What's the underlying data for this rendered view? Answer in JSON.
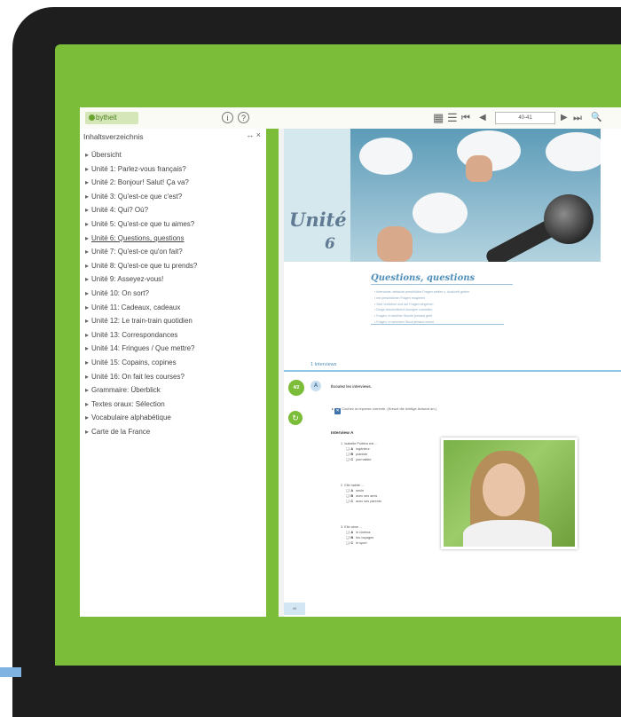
{
  "app": {
    "logo_text": "bytheit"
  },
  "toolbar": {
    "info_label": "i",
    "help_label": "?",
    "grid_icon": "▦",
    "list_icon": "☰",
    "first_icon": "⏮",
    "prev_icon": "◀",
    "page_value": "40-41",
    "next_icon": "▶",
    "last_icon": "⏭",
    "zoom_icon": "🔍"
  },
  "toc": {
    "title": "Inhaltsverzeichnis",
    "expand_label": "↔",
    "close_label": "×",
    "items": [
      "Übersicht",
      "Unité 1: Parlez-vous français?",
      "Unité 2: Bonjour! Salut! Ça va?",
      "Unité 3: Qu'est-ce que c'est?",
      "Unité 4: Qui? Où?",
      "Unité 5: Qu'est-ce que tu aimes?",
      "Unité 6: Questions, questions",
      "Unité 7: Qu'est-ce qu'on fait?",
      "Unité 8: Qu'est-ce que tu prends?",
      "Unité 9: Asseyez-vous!",
      "Unité 10: On sort?",
      "Unité 11: Cadeaux, cadeaux",
      "Unité 12: Le train-train quotidien",
      "Unité 13: Correspondances",
      "Unité 14: Fringues / Que mettre?",
      "Unité 15: Copains, copines",
      "Unité 16: On fait les courses?",
      "Grammaire: Überblick",
      "Textes oraux: Sélection",
      "Vocabulaire alphabétique",
      "Carte de la France"
    ]
  },
  "page": {
    "unit_label": "Unité",
    "unit_number": "6",
    "section_title": "Questions, questions",
    "goals": [
      "Interviews: einfache persönliche Fragen stellen u. Auskunft geben",
      "mit persönlichen Fragen reagieren",
      "Sich Vorlieben und auf Fragen eingehen",
      "Dinge beschreiben/Lösungen vorstellen",
      "Fragen, in welcher Stunde jemand geht",
      "Fragen, in welchem Stock jemand wohnt"
    ],
    "tab_label": "1 Interviews",
    "track_label": "4/2",
    "exercise_letter": "A",
    "instruction": "Écoutez les interviews.",
    "sub_instruction": "Cochez  la réponse correcte. (Kreuzt die richtige Antwort an.)",
    "interview_heading": "Interview A",
    "questions": [
      {
        "num": "1",
        "text": "Isabelle Poitiers est ...",
        "options": [
          {
            "letter": "A",
            "text": "ingénieur"
          },
          {
            "letter": "B",
            "text": "pianiste"
          },
          {
            "letter": "C",
            "text": "journaliste"
          }
        ]
      },
      {
        "num": "2",
        "text": "Elle habite ...",
        "options": [
          {
            "letter": "A",
            "text": "seule"
          },
          {
            "letter": "B",
            "text": "avec ses amis"
          },
          {
            "letter": "C",
            "text": "avec ses parents"
          }
        ]
      },
      {
        "num": "3",
        "text": "Elle aime ...",
        "options": [
          {
            "letter": "A",
            "text": "le cinéma"
          },
          {
            "letter": "B",
            "text": "les voyages"
          },
          {
            "letter": "C",
            "text": "le sport"
          }
        ]
      }
    ],
    "page_number": "40"
  }
}
